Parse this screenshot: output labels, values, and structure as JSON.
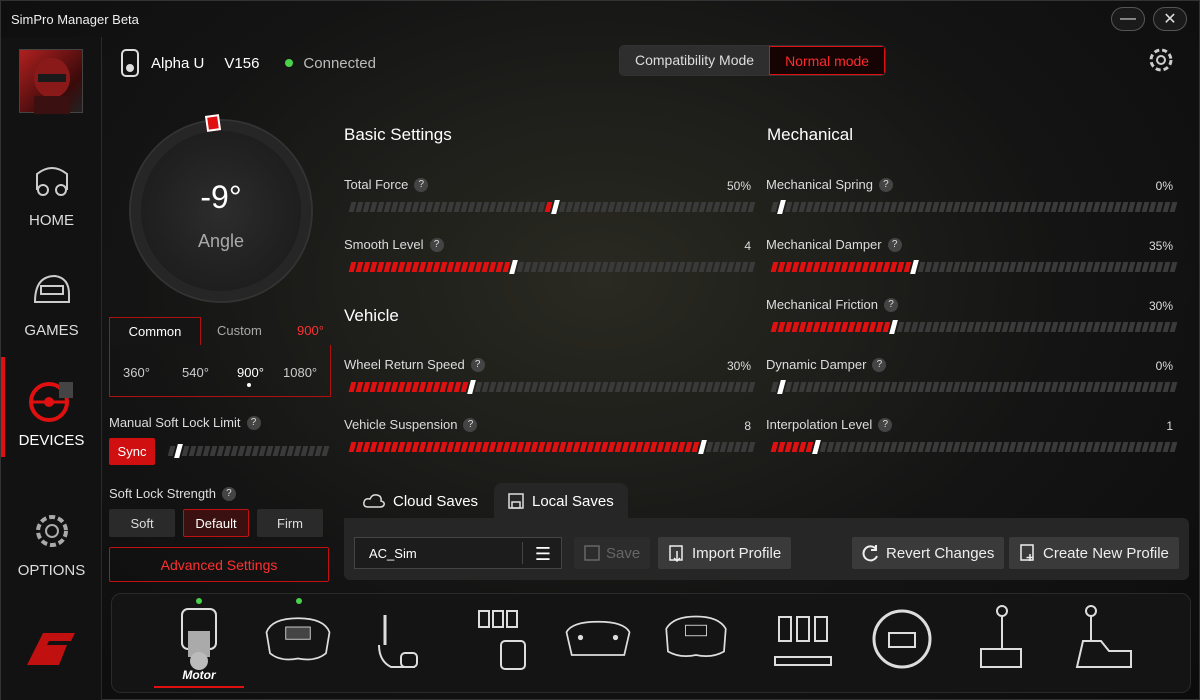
{
  "app": {
    "title": "SimPro Manager Beta",
    "minimize_icon": "minimize-icon",
    "close_icon": "close-icon"
  },
  "sidebar": {
    "items": [
      {
        "label": "HOME",
        "icon": "home-car-icon"
      },
      {
        "label": "GAMES",
        "icon": "helmet-icon"
      },
      {
        "label": "DEVICES",
        "icon": "steering-wheel-icon"
      },
      {
        "label": "OPTIONS",
        "icon": "gear-icon"
      }
    ],
    "active": "DEVICES"
  },
  "device": {
    "name": "Alpha U",
    "version": "V156",
    "status": "Connected"
  },
  "modes": {
    "compat": "Compatibility Mode",
    "normal": "Normal mode"
  },
  "dial": {
    "value": "-9°",
    "label": "Angle"
  },
  "angle_tabs": {
    "common": "Common",
    "custom": "Custom",
    "custom_value": "900°",
    "options": [
      "360°",
      "540°",
      "900°",
      "1080°"
    ],
    "selected": "900°"
  },
  "soft_lock": {
    "label": "Manual Soft Lock Limit",
    "sync": "Sync"
  },
  "soft_lock_strength": {
    "label": "Soft Lock Strength",
    "options": [
      "Soft",
      "Default",
      "Firm"
    ],
    "selected": "Default"
  },
  "advanced": "Advanced Settings",
  "sections": {
    "basic": "Basic Settings",
    "vehicle": "Vehicle",
    "mechanical": "Mechanical"
  },
  "basic": [
    {
      "label": "Total Force",
      "value": "50%",
      "level": 0.5,
      "centered": true
    },
    {
      "label": "Smooth Level",
      "value": "4",
      "level": 0.4
    }
  ],
  "vehicle": [
    {
      "label": "Wheel Return Speed",
      "value": "30%",
      "level": 0.3
    },
    {
      "label": "Vehicle Suspension",
      "value": "8",
      "level": 0.88
    }
  ],
  "mechanical": [
    {
      "label": "Mechanical Spring",
      "value": "0%",
      "level": 0.0
    },
    {
      "label": "Mechanical Damper",
      "value": "35%",
      "level": 0.35
    },
    {
      "label": "Mechanical Friction",
      "value": "30%",
      "level": 0.3
    },
    {
      "label": "Dynamic Damper",
      "value": "0%",
      "level": 0.0
    },
    {
      "label": "Interpolation Level",
      "value": "1",
      "level": 0.1
    }
  ],
  "saves": {
    "cloud": "Cloud Saves",
    "local": "Local Saves",
    "profile": "AC_Sim",
    "save": "Save",
    "import": "Import Profile",
    "revert": "Revert Changes",
    "create": "Create New Profile"
  },
  "devices": {
    "selected": "Motor",
    "icons": [
      "motor-icon",
      "formula-wheel-icon",
      "shifter-handbrake-icon",
      "pedal-set-icon",
      "formula-wheel-outline-icon",
      "gt-wheel-icon",
      "pedals-icon",
      "round-wheel-icon",
      "handbrake-icon",
      "sequential-shifter-icon"
    ]
  }
}
